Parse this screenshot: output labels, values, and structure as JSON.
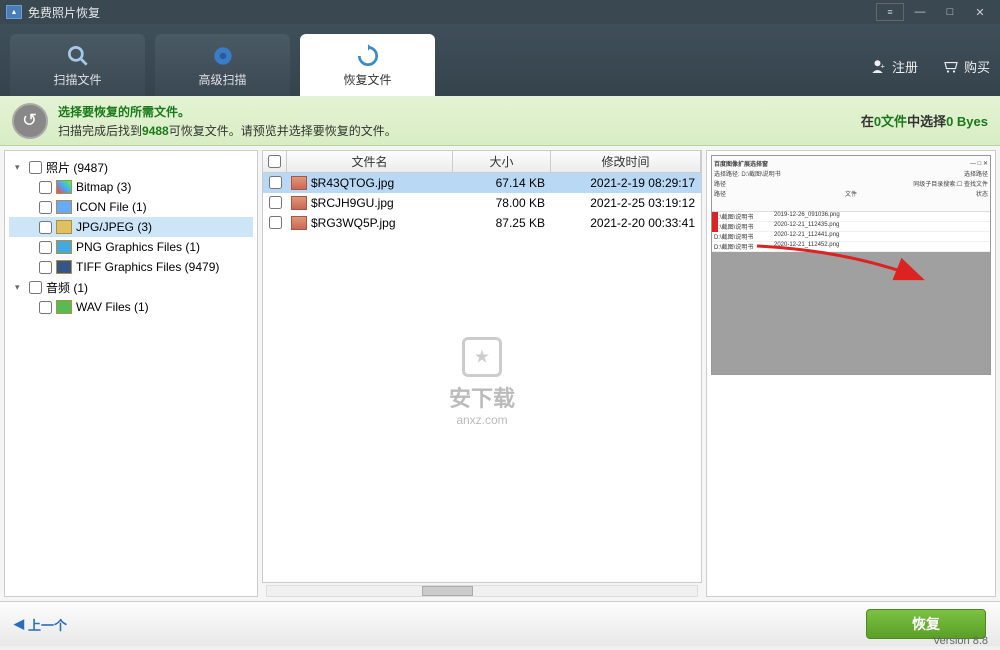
{
  "app": {
    "title": "免费照片恢复"
  },
  "window_buttons": {
    "menu": "≡",
    "min": "—",
    "max": "□",
    "close": "✕"
  },
  "tabs": [
    {
      "label": "扫描文件"
    },
    {
      "label": "高级扫描"
    },
    {
      "label": "恢复文件"
    }
  ],
  "header_actions": {
    "register": "注册",
    "buy": "购买"
  },
  "info": {
    "title": "选择要恢复的所需文件。",
    "prefix": "扫描完成后找到",
    "count": "9488",
    "suffix": "可恢复文件。请预览并选择要恢复的文件。",
    "status_prefix": "在",
    "status_mid": "0文件",
    "status_mid2": "中选择",
    "status_bytes": "0 Byes"
  },
  "tree": {
    "category_photo": "照片 (9487)",
    "items": [
      {
        "label": "Bitmap (3)",
        "icon": "bmp"
      },
      {
        "label": "ICON File (1)",
        "icon": "icon"
      },
      {
        "label": "JPG/JPEG (3)",
        "icon": "jpg",
        "selected": true
      },
      {
        "label": "PNG Graphics Files (1)",
        "icon": "png"
      },
      {
        "label": "TIFF Graphics Files (9479)",
        "icon": "tiff"
      }
    ],
    "category_audio": "音频 (1)",
    "audio_items": [
      {
        "label": "WAV Files (1)",
        "icon": "wav"
      }
    ]
  },
  "columns": {
    "name": "文件名",
    "size": "大小",
    "modified": "修改时间"
  },
  "files": [
    {
      "name": "$R43QTOG.jpg",
      "size": "67.14 KB",
      "date": "2021-2-19 08:29:17",
      "selected": true
    },
    {
      "name": "$RCJH9GU.jpg",
      "size": "78.00 KB",
      "date": "2021-2-25 03:19:12"
    },
    {
      "name": "$RG3WQ5P.jpg",
      "size": "87.25 KB",
      "date": "2021-2-20 00:33:41"
    }
  ],
  "preview": {
    "title": "百度图像扩展选择窗",
    "label1": "选择路径:",
    "path": "D:\\截图\\说明书",
    "btn1": "选择路径",
    "btn2": "查找文件",
    "chk": "同级子目录搜索:",
    "col_path": "路径",
    "col_file": "文件",
    "col_status": "状态",
    "rows": [
      {
        "p": "D:\\截图\\说明书",
        "f": "2019-12-26_091036.png"
      },
      {
        "p": "D:\\截图\\说明书",
        "f": "2020-12-21_112435.png"
      },
      {
        "p": "D:\\截图\\说明书",
        "f": "2020-12-21_112441.png"
      },
      {
        "p": "D:\\截图\\说明书",
        "f": "2020-12-21_112452.png"
      }
    ]
  },
  "watermark": {
    "text1": "安下载",
    "text2": "anxz.com"
  },
  "footer": {
    "prev": "上一个",
    "recover": "恢复"
  },
  "version": "Version 8.8"
}
